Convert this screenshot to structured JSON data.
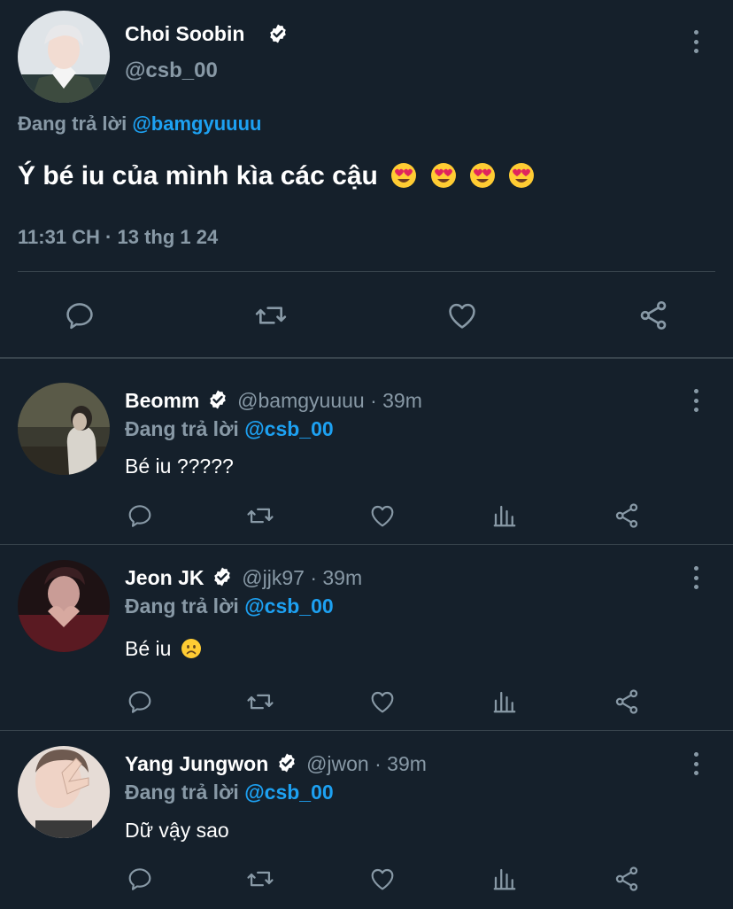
{
  "main_tweet": {
    "author_name": "Choi Soobin",
    "author_handle": "@csb_00",
    "reply_prefix": "Đang trả lời",
    "reply_to": "@bamgyuuuu",
    "text": "Ý bé iu của mình kìa các cậu",
    "text_emojis": [
      "heart-eyes-emoji",
      "heart-eyes-emoji",
      "heart-eyes-emoji",
      "heart-eyes-emoji"
    ],
    "timestamp": "11:31 CH · 13 thg 1 24"
  },
  "replies": [
    {
      "author_name": "Beomm",
      "author_handle": "@bamgyuuuu",
      "time": "· 39m",
      "reply_prefix": "Đang trả lời",
      "reply_to": "@csb_00",
      "text": "Bé iu ?????"
    },
    {
      "author_name": "Jeon JK",
      "author_handle": "@jjk97",
      "time": "· 39m",
      "reply_prefix": "Đang trả lời",
      "reply_to": "@csb_00",
      "text": "Bé iu",
      "text_emoji": "frowning-face-emoji"
    },
    {
      "author_name": "Yang Jungwon",
      "author_handle": "@jwon",
      "time": "· 39m",
      "reply_prefix": "Đang trả lời",
      "reply_to": "@csb_00",
      "text": "Dữ vậy sao"
    }
  ],
  "colors": {
    "background": "#15202b",
    "divider": "#38444d",
    "secondary_text": "#8899a6",
    "accent_link": "#1da1f2",
    "text": "#ffffff"
  }
}
